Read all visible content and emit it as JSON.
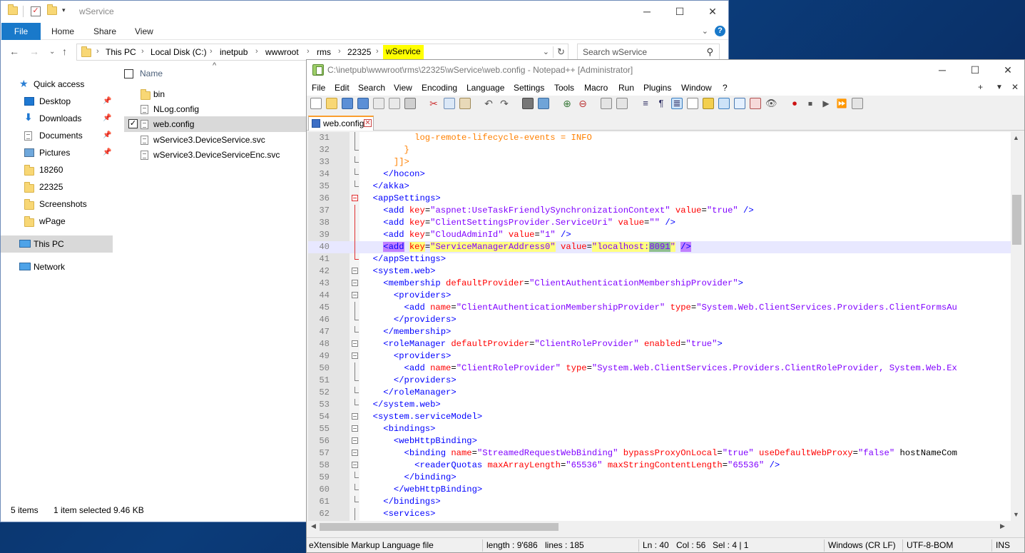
{
  "explorer": {
    "title": "wService",
    "ribbon_tabs": [
      "File",
      "Home",
      "Share",
      "View"
    ],
    "breadcrumb": [
      "This PC",
      "Local Disk (C:)",
      "inetpub",
      "wwwroot",
      "rms",
      "22325",
      "wService"
    ],
    "search_placeholder": "Search wService",
    "nav": {
      "quick_access": "Quick access",
      "pinned": [
        "Desktop",
        "Downloads",
        "Documents",
        "Pictures"
      ],
      "folders": [
        "18260",
        "22325",
        "Screenshots",
        "wPage"
      ],
      "this_pc": "This PC",
      "network": "Network"
    },
    "column_header": "Name",
    "files": [
      "bin",
      "NLog.config",
      "web.config",
      "wService3.DeviceService.svc",
      "wService3.DeviceServiceEnc.svc"
    ],
    "selected_file": "web.config",
    "status": {
      "items": "5 items",
      "selection": "1 item selected",
      "size": "9.46 KB"
    }
  },
  "npp": {
    "title": "C:\\inetpub\\wwwroot\\rms\\22325\\wService\\web.config - Notepad++ [Administrator]",
    "menu": [
      "File",
      "Edit",
      "Search",
      "View",
      "Encoding",
      "Language",
      "Settings",
      "Tools",
      "Macro",
      "Run",
      "Plugins",
      "Window",
      "?"
    ],
    "menu_right": [
      "+",
      "▼",
      "✕"
    ],
    "tab": "web.config",
    "lines": [
      {
        "n": "31",
        "t": "          log-remote-lifecycle-events = INFO"
      },
      {
        "n": "32",
        "t": "        }"
      },
      {
        "n": "33",
        "t": "      ]]>"
      },
      {
        "n": "34",
        "t": "    </hocon>"
      },
      {
        "n": "35",
        "t": "  </akka>"
      },
      {
        "n": "36",
        "t": "  <appSettings>"
      },
      {
        "n": "37",
        "t": "    <add key=\"aspnet:UseTaskFriendlySynchronizationContext\" value=\"true\" />"
      },
      {
        "n": "38",
        "t": "    <add key=\"ClientSettingsProvider.ServiceUri\" value=\"\" />"
      },
      {
        "n": "39",
        "t": "    <add key=\"CloudAdminId\" value=\"1\" />"
      },
      {
        "n": "40",
        "t": "    <add key=\"ServiceManagerAddress0\" value=\"localhost:8091\" />"
      },
      {
        "n": "41",
        "t": "  </appSettings>"
      },
      {
        "n": "42",
        "t": "  <system.web>"
      },
      {
        "n": "43",
        "t": "    <membership defaultProvider=\"ClientAuthenticationMembershipProvider\">"
      },
      {
        "n": "44",
        "t": "      <providers>"
      },
      {
        "n": "45",
        "t": "        <add name=\"ClientAuthenticationMembershipProvider\" type=\"System.Web.ClientServices.Providers.ClientFormsAu"
      },
      {
        "n": "46",
        "t": "      </providers>"
      },
      {
        "n": "47",
        "t": "    </membership>"
      },
      {
        "n": "48",
        "t": "    <roleManager defaultProvider=\"ClientRoleProvider\" enabled=\"true\">"
      },
      {
        "n": "49",
        "t": "      <providers>"
      },
      {
        "n": "50",
        "t": "        <add name=\"ClientRoleProvider\" type=\"System.Web.ClientServices.Providers.ClientRoleProvider, System.Web.Ex"
      },
      {
        "n": "51",
        "t": "      </providers>"
      },
      {
        "n": "52",
        "t": "    </roleManager>"
      },
      {
        "n": "53",
        "t": "  </system.web>"
      },
      {
        "n": "54",
        "t": "  <system.serviceModel>"
      },
      {
        "n": "55",
        "t": "    <bindings>"
      },
      {
        "n": "56",
        "t": "      <webHttpBinding>"
      },
      {
        "n": "57",
        "t": "        <binding name=\"StreamedRequestWebBinding\" bypassProxyOnLocal=\"true\" useDefaultWebProxy=\"false\" hostNameCom"
      },
      {
        "n": "58",
        "t": "          <readerQuotas maxArrayLength=\"65536\" maxStringContentLength=\"65536\" />"
      },
      {
        "n": "59",
        "t": "        </binding>"
      },
      {
        "n": "60",
        "t": "      </webHttpBinding>"
      },
      {
        "n": "61",
        "t": "    </bindings>"
      },
      {
        "n": "62",
        "t": "    <services>"
      }
    ],
    "status": {
      "filetype": "eXtensible Markup Language file",
      "length": "length : 9'686",
      "lines": "lines : 185",
      "ln": "Ln : 40",
      "col": "Col : 56",
      "sel": "Sel : 4 | 1",
      "eol": "Windows (CR LF)",
      "encoding": "UTF-8-BOM",
      "mode": "INS"
    }
  }
}
